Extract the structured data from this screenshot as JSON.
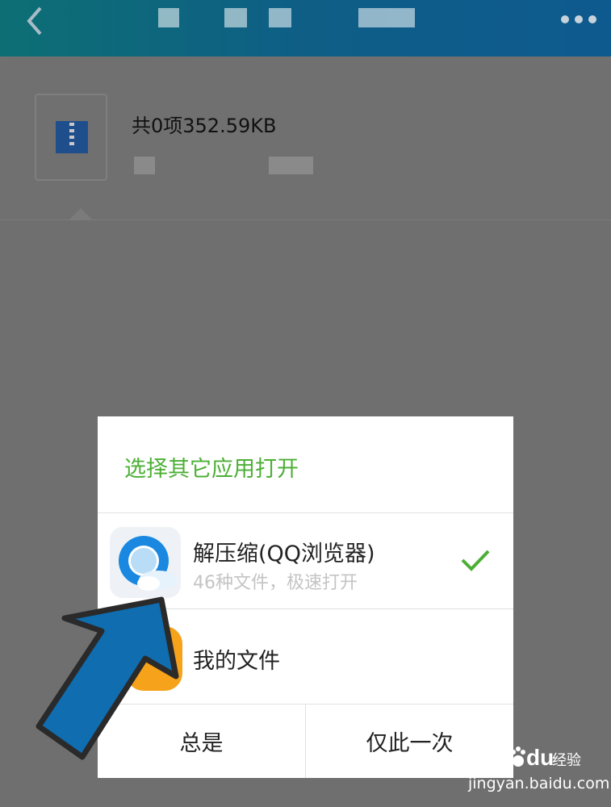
{
  "header": {
    "back_icon": "chevron-left-icon",
    "more_icon": "more-dots-icon",
    "colors": {
      "bar_start": "#0d6f74",
      "bar_end": "#0e5a8f"
    }
  },
  "file": {
    "title": "共0项352.59KB",
    "icon": "zip-file-icon"
  },
  "dialog": {
    "title": "选择其它应用打开",
    "apps": [
      {
        "name": "解压缩(QQ浏览器)",
        "subtitle": "46种文件，极速打开",
        "icon": "qq-browser-icon",
        "selected": true
      },
      {
        "name": "我的文件",
        "icon": "my-files-icon",
        "selected": false
      }
    ],
    "buttons": {
      "always": "总是",
      "once": "仅此一次"
    },
    "accent_color": "#4caf35"
  },
  "watermark": {
    "logo": "Bai du 经验",
    "url": "jingyan.baidu.com"
  }
}
